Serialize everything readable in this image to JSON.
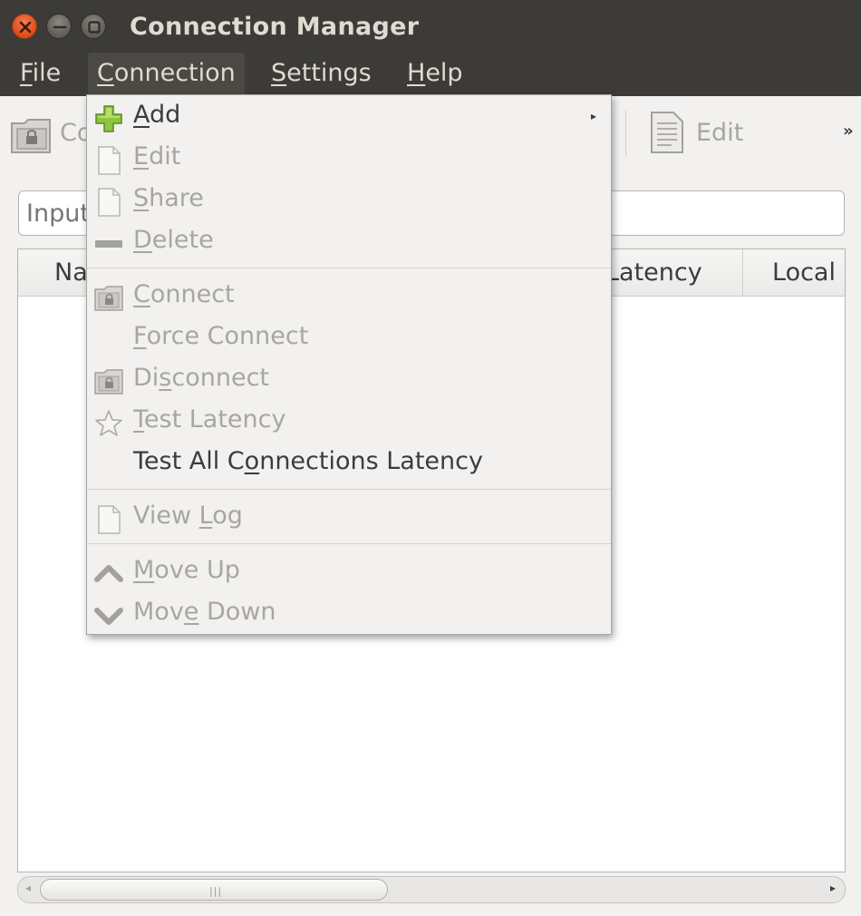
{
  "window": {
    "title": "Connection Manager"
  },
  "menubar": {
    "items": [
      {
        "pre": "",
        "u": "F",
        "post": "ile"
      },
      {
        "pre": "",
        "u": "C",
        "post": "onnection"
      },
      {
        "pre": "",
        "u": "S",
        "post": "ettings"
      },
      {
        "pre": "",
        "u": "H",
        "post": "elp"
      }
    ]
  },
  "toolbar": {
    "connect_label_partial": "Co",
    "edit_label": "Edit",
    "overflow": "»"
  },
  "search": {
    "placeholder": "Input"
  },
  "table": {
    "columns": [
      "Na",
      "Latency",
      "Local"
    ]
  },
  "connection_menu": {
    "items": [
      {
        "pre": "",
        "u": "A",
        "post": "dd",
        "enabled": true,
        "icon": "add-icon",
        "submenu": true
      },
      {
        "pre": "",
        "u": "E",
        "post": "dit",
        "enabled": false,
        "icon": "document-icon"
      },
      {
        "pre": "",
        "u": "S",
        "post": "hare",
        "enabled": false,
        "icon": "document-icon"
      },
      {
        "pre": "",
        "u": "D",
        "post": "elete",
        "enabled": false,
        "icon": "minus-icon"
      },
      {
        "pre": "",
        "u": "C",
        "post": "onnect",
        "enabled": false,
        "icon": "lock-folder-icon"
      },
      {
        "pre": "",
        "u": "F",
        "post": "orce Connect",
        "enabled": false,
        "icon": ""
      },
      {
        "pre": "Di",
        "u": "s",
        "post": "connect",
        "enabled": false,
        "icon": "lock-folder-icon"
      },
      {
        "pre": "",
        "u": "T",
        "post": "est Latency",
        "enabled": false,
        "icon": "star-icon"
      },
      {
        "pre": "Test All C",
        "u": "o",
        "post": "nnections Latency",
        "enabled": true,
        "icon": ""
      },
      {
        "pre": "View ",
        "u": "L",
        "post": "og",
        "enabled": false,
        "icon": "document-icon"
      },
      {
        "pre": "",
        "u": "M",
        "post": "ove Up",
        "enabled": false,
        "icon": "chevron-up-icon"
      },
      {
        "pre": "Mov",
        "u": "e",
        "post": " Down",
        "enabled": false,
        "icon": "chevron-down-icon"
      }
    ]
  }
}
